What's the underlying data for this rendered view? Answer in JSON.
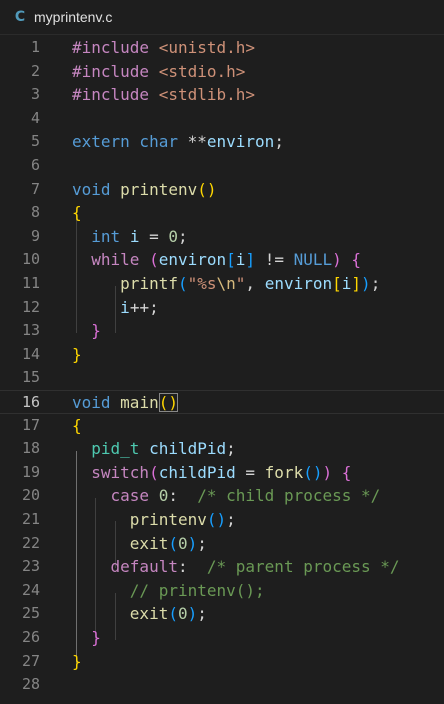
{
  "tab": {
    "icon_glyph": "C",
    "icon_name": "c-language-icon",
    "filename": "myprintenv.c"
  },
  "colors": {
    "background": "#1e1e1e",
    "keyword": "#569cd6",
    "control": "#c586c0",
    "function": "#dcdcaa",
    "variable": "#9cdcfe",
    "type": "#4ec9b0",
    "string": "#ce9178",
    "escape": "#d7ba7d",
    "number": "#b5cea8",
    "comment": "#6a9955",
    "bracket_1": "#ffd700",
    "bracket_2": "#da70d6",
    "bracket_3": "#179fff"
  },
  "editor": {
    "active_line": 16
  },
  "lines": [
    {
      "n": "1",
      "tokens": [
        [
          "c",
          "#include"
        ],
        [
          "",
          ""
        ],
        [
          "s",
          " <unistd.h>"
        ]
      ]
    },
    {
      "n": "2",
      "tokens": [
        [
          "c",
          "#include"
        ],
        [
          "s",
          " <stdio.h>"
        ]
      ]
    },
    {
      "n": "3",
      "tokens": [
        [
          "c",
          "#include"
        ],
        [
          "s",
          " <stdlib.h>"
        ]
      ]
    },
    {
      "n": "4",
      "tokens": []
    },
    {
      "n": "5",
      "tokens": [
        [
          "k",
          "extern"
        ],
        [
          "",
          ""
        ],
        [
          "k",
          " char"
        ],
        [
          "",
          " **"
        ],
        [
          "v",
          "environ"
        ],
        [
          "",
          ";"
        ]
      ]
    },
    {
      "n": "6",
      "tokens": []
    },
    {
      "n": "7",
      "tokens": [
        [
          "k",
          "void"
        ],
        [
          "",
          " "
        ],
        [
          "f",
          "printenv"
        ],
        [
          "p1",
          "()"
        ]
      ]
    },
    {
      "n": "8",
      "tokens": [
        [
          "p1",
          "{"
        ]
      ]
    },
    {
      "n": "9",
      "tokens": [
        [
          "",
          "  "
        ],
        [
          "k",
          "int"
        ],
        [
          "",
          " "
        ],
        [
          "v",
          "i"
        ],
        [
          "",
          " = "
        ],
        [
          "n",
          "0"
        ],
        [
          "",
          ";"
        ]
      ]
    },
    {
      "n": "10",
      "tokens": [
        [
          "",
          "  "
        ],
        [
          "c",
          "while"
        ],
        [
          "",
          " "
        ],
        [
          "p2",
          "("
        ],
        [
          "v",
          "environ"
        ],
        [
          "p3",
          "["
        ],
        [
          "v",
          "i"
        ],
        [
          "p3",
          "]"
        ],
        [
          "",
          " != "
        ],
        [
          "k",
          "NULL"
        ],
        [
          "p2",
          ")"
        ],
        [
          "",
          " "
        ],
        [
          "p2",
          "{"
        ]
      ]
    },
    {
      "n": "11",
      "tokens": [
        [
          "",
          "     "
        ],
        [
          "f",
          "printf"
        ],
        [
          "p3",
          "("
        ],
        [
          "s",
          "\"%s"
        ],
        [
          "e",
          "\\n"
        ],
        [
          "s",
          "\""
        ],
        [
          "",
          ", "
        ],
        [
          "v",
          "environ"
        ],
        [
          "p1",
          "["
        ],
        [
          "v",
          "i"
        ],
        [
          "p1",
          "]"
        ],
        [
          "p3",
          ")"
        ],
        [
          "",
          ";"
        ]
      ]
    },
    {
      "n": "12",
      "tokens": [
        [
          "",
          "     "
        ],
        [
          "v",
          "i"
        ],
        [
          "",
          "++;"
        ]
      ]
    },
    {
      "n": "13",
      "tokens": [
        [
          "",
          "  "
        ],
        [
          "p2",
          "}"
        ]
      ]
    },
    {
      "n": "14",
      "tokens": [
        [
          "p1",
          "}"
        ]
      ]
    },
    {
      "n": "15",
      "tokens": []
    },
    {
      "n": "16",
      "tokens": [
        [
          "k",
          "void"
        ],
        [
          "",
          " "
        ],
        [
          "f",
          "main"
        ],
        [
          "p1m",
          "()"
        ]
      ]
    },
    {
      "n": "17",
      "tokens": [
        [
          "p1",
          "{"
        ]
      ]
    },
    {
      "n": "18",
      "tokens": [
        [
          "",
          "  "
        ],
        [
          "t",
          "pid_t"
        ],
        [
          "",
          " "
        ],
        [
          "v",
          "childPid"
        ],
        [
          "",
          ";"
        ]
      ]
    },
    {
      "n": "19",
      "tokens": [
        [
          "",
          "  "
        ],
        [
          "c",
          "switch"
        ],
        [
          "p2",
          "("
        ],
        [
          "v",
          "childPid"
        ],
        [
          "",
          " = "
        ],
        [
          "f",
          "fork"
        ],
        [
          "p3",
          "()"
        ],
        [
          "p2",
          ")"
        ],
        [
          "",
          " "
        ],
        [
          "p2",
          "{"
        ]
      ]
    },
    {
      "n": "20",
      "tokens": [
        [
          "",
          "    "
        ],
        [
          "c",
          "case"
        ],
        [
          "",
          " "
        ],
        [
          "n",
          "0"
        ],
        [
          "",
          ":  "
        ],
        [
          "cm",
          "/* child process */"
        ]
      ]
    },
    {
      "n": "21",
      "tokens": [
        [
          "",
          "      "
        ],
        [
          "f",
          "printenv"
        ],
        [
          "p3",
          "()"
        ],
        [
          "",
          ";"
        ]
      ]
    },
    {
      "n": "22",
      "tokens": [
        [
          "",
          "      "
        ],
        [
          "f",
          "exit"
        ],
        [
          "p3",
          "("
        ],
        [
          "n",
          "0"
        ],
        [
          "p3",
          ")"
        ],
        [
          "",
          ";"
        ]
      ]
    },
    {
      "n": "23",
      "tokens": [
        [
          "",
          "    "
        ],
        [
          "c",
          "default"
        ],
        [
          "",
          ":  "
        ],
        [
          "cm",
          "/* parent process */"
        ]
      ]
    },
    {
      "n": "24",
      "tokens": [
        [
          "",
          "      "
        ],
        [
          "cm",
          "// printenv();"
        ]
      ]
    },
    {
      "n": "25",
      "tokens": [
        [
          "",
          "      "
        ],
        [
          "f",
          "exit"
        ],
        [
          "p3",
          "("
        ],
        [
          "n",
          "0"
        ],
        [
          "p3",
          ")"
        ],
        [
          "",
          ";"
        ]
      ]
    },
    {
      "n": "26",
      "tokens": [
        [
          "",
          "  "
        ],
        [
          "p2",
          "}"
        ]
      ]
    },
    {
      "n": "27",
      "tokens": [
        [
          "p1",
          "}"
        ]
      ]
    },
    {
      "n": "28",
      "tokens": []
    }
  ]
}
